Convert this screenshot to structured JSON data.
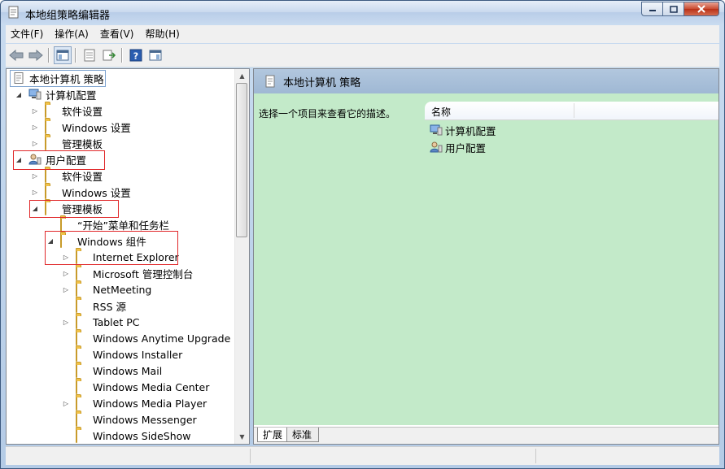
{
  "window": {
    "title": "本地组策略编辑器"
  },
  "menu": [
    "文件(F)",
    "操作(A)",
    "查看(V)",
    "帮助(H)"
  ],
  "tree": {
    "root": "本地计算机 策略",
    "computer_config": "计算机配置",
    "cc_software": "软件设置",
    "cc_windows": "Windows 设置",
    "cc_admin": "管理模板",
    "user_config": "用户配置",
    "uc_software": "软件设置",
    "uc_windows": "Windows 设置",
    "uc_admin": "管理模板",
    "start_menu": "“开始”菜单和任务栏",
    "windows_components": "Windows 组件",
    "components": [
      "Internet Explorer",
      "Microsoft 管理控制台",
      "NetMeeting",
      "RSS 源",
      "Tablet PC",
      "Windows Anytime Upgrade",
      "Windows Installer",
      "Windows Mail",
      "Windows Media Center",
      "Windows Media Player",
      "Windows Messenger",
      "Windows SideShow"
    ]
  },
  "details": {
    "header": "本地计算机 策略",
    "description": "选择一个项目来查看它的描述。",
    "column_name": "名称",
    "items": [
      "计算机配置",
      "用户配置"
    ]
  },
  "tabs": [
    "扩展",
    "标准"
  ]
}
